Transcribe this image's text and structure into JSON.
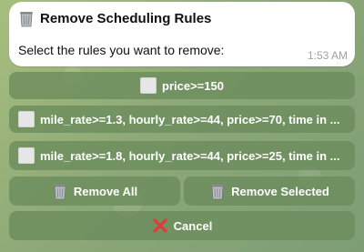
{
  "message": {
    "title": "Remove Scheduling Rules",
    "prompt": "Select the rules you want to remove:",
    "time": "1:53 AM",
    "title_icon": "wastebasket-icon"
  },
  "keyboard": {
    "rules": [
      {
        "label": "price>=150",
        "icon": "unchecked-box-icon"
      },
      {
        "label": "mile_rate>=1.3, hourly_rate>=44, price>=70, time in ...",
        "icon": "unchecked-box-icon"
      },
      {
        "label": "mile_rate>=1.8, hourly_rate>=44, price>=25, time in ...",
        "icon": "unchecked-box-icon"
      }
    ],
    "remove_all_label": "Remove All",
    "remove_selected_label": "Remove Selected",
    "cancel_label": "Cancel"
  },
  "colors": {
    "button_bg": "#6c8c5c",
    "bubble_bg": "#ffffff",
    "cancel_x": "#e03b3b"
  }
}
